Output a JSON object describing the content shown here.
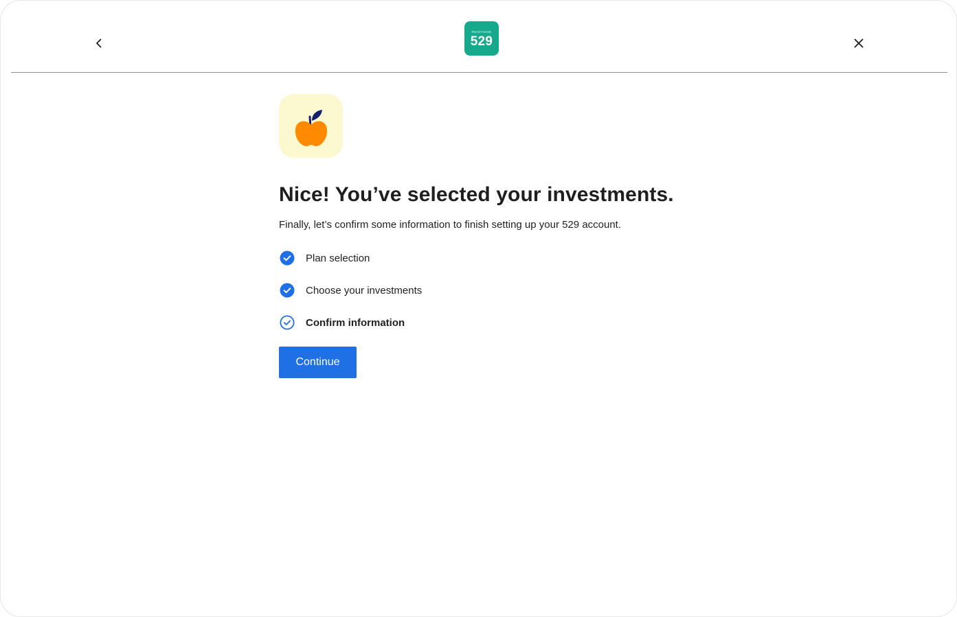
{
  "header": {
    "back_icon": "chevron-left-icon",
    "close_icon": "close-icon",
    "logo": {
      "small_text": "READYSAVE",
      "number": "529",
      "color": "#16a98c"
    }
  },
  "main": {
    "hero_icon": "apple-icon",
    "title": "Nice! You’ve selected your investments.",
    "subtitle": "Finally, let’s confirm some information to finish setting up your 529 account.",
    "steps": [
      {
        "label": "Plan selection",
        "status": "complete"
      },
      {
        "label": "Choose your investments",
        "status": "complete"
      },
      {
        "label": "Confirm information",
        "status": "current"
      }
    ],
    "continue_label": "Continue"
  },
  "colors": {
    "accent": "#1f6fe5",
    "brand": "#16a98c",
    "icon_bg": "#fcf8cf",
    "apple": "#ff8a00",
    "leaf": "#14206b"
  }
}
